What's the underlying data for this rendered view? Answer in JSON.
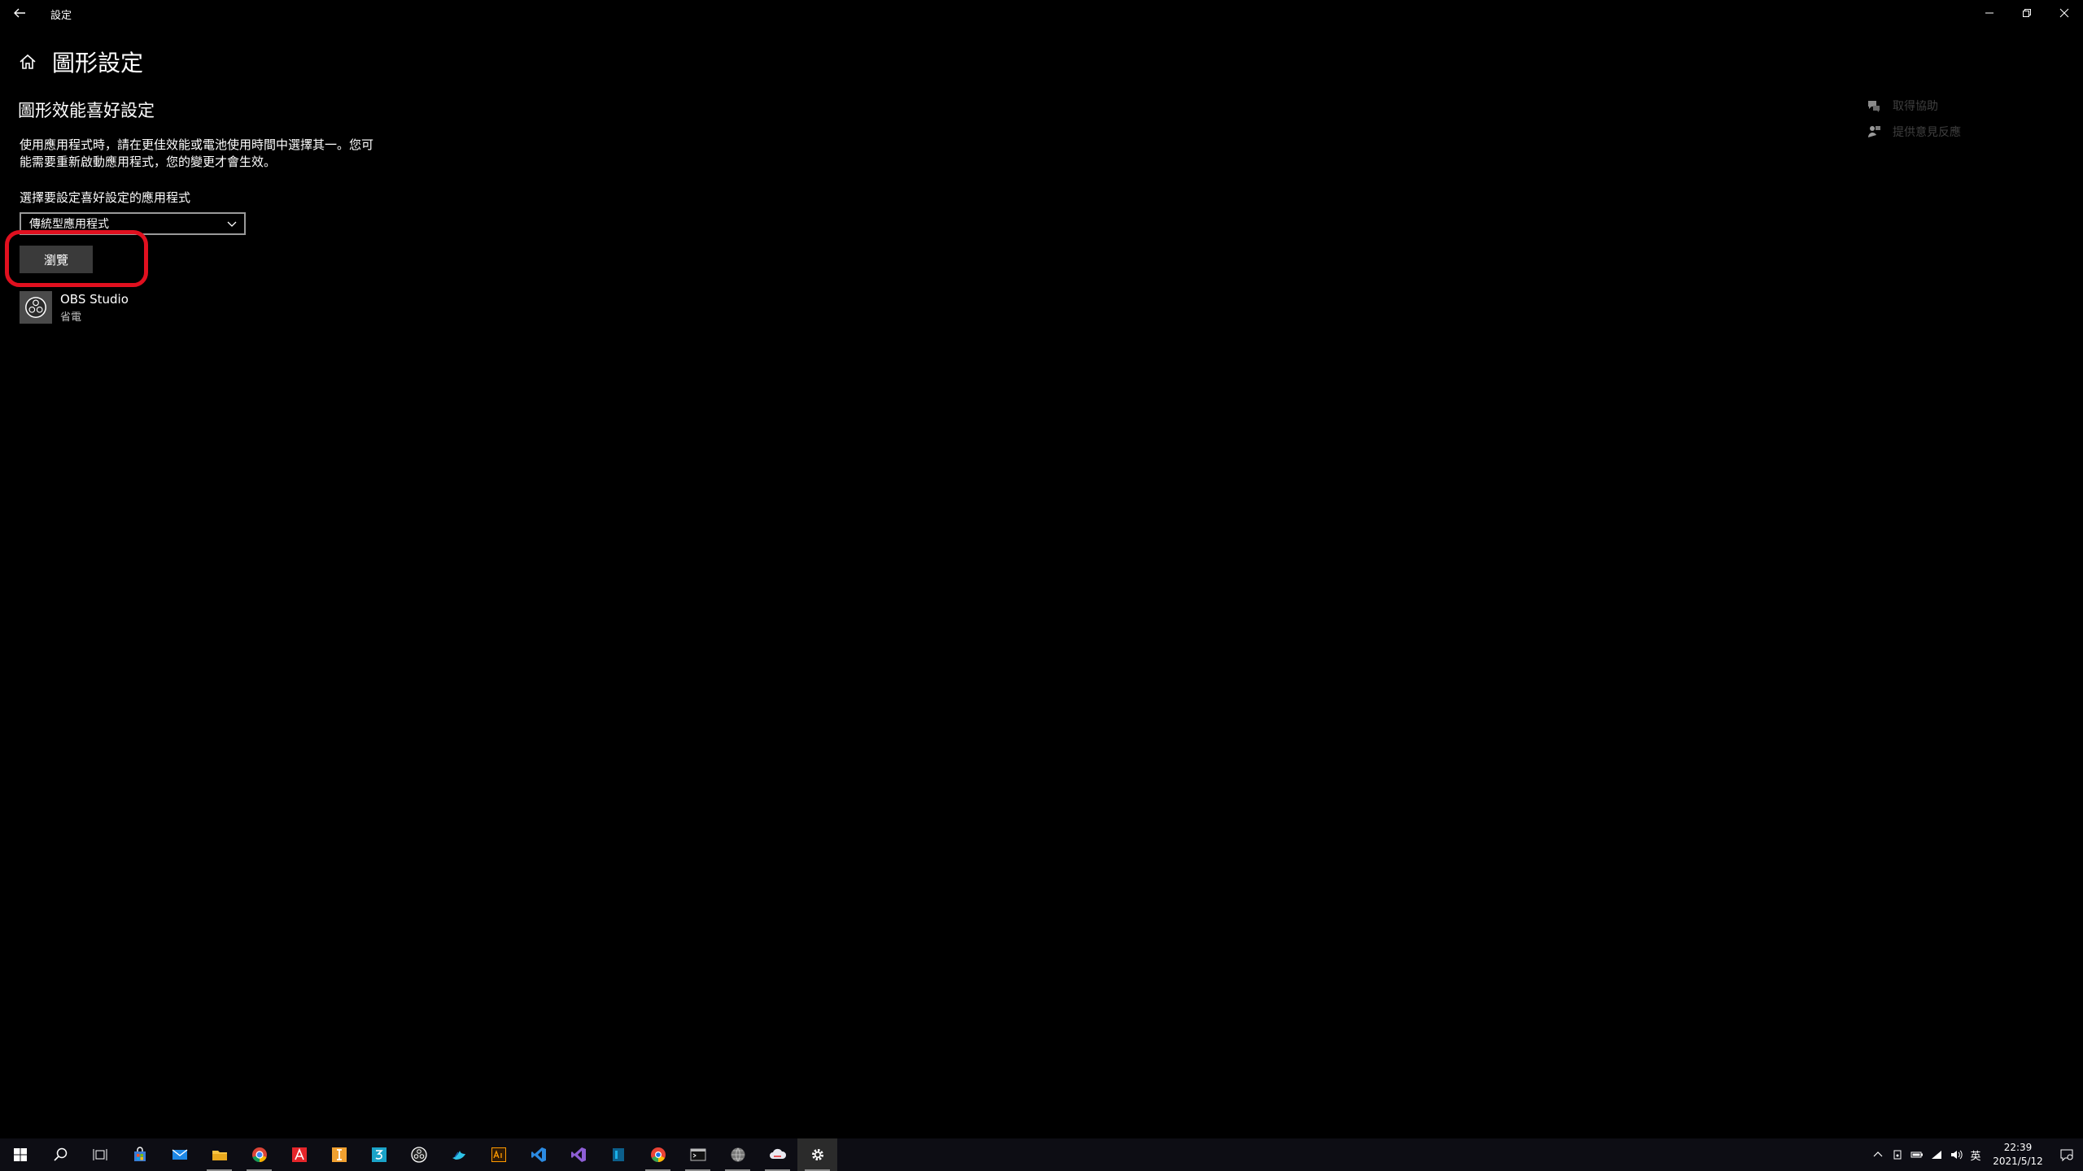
{
  "window": {
    "title": "設定",
    "controls": [
      "minimize-icon",
      "restore-icon",
      "close-icon"
    ]
  },
  "header": {
    "title": "圖形設定"
  },
  "section": {
    "title": "圖形效能喜好設定",
    "description_line1": "使用應用程式時，請在更佳效能或電池使用時間中選擇其一。您可",
    "description_line2": "能需要重新啟動應用程式，您的變更才會生效。",
    "select_label": "選擇要設定喜好設定的應用程式",
    "dropdown_value": "傳統型應用程式",
    "browse_label": "瀏覽",
    "highlight_color": "#e0101f"
  },
  "apps": [
    {
      "name": "OBS Studio",
      "mode": "省電",
      "icon": "obs-icon"
    }
  ],
  "side_links": [
    {
      "label": "取得協助",
      "icon": "help-chat-icon"
    },
    {
      "label": "提供意見反應",
      "icon": "feedback-icon"
    }
  ],
  "taskbar": {
    "items": [
      "windows-start-icon",
      "search-icon",
      "task-view-icon",
      "store-icon",
      "mail-icon",
      "file-explorer-icon",
      "chrome-icon",
      "acrobat-icon",
      "illustrator-i-icon",
      "app-3-icon",
      "obs-icon",
      "app-bird-icon",
      "illustrator-icon",
      "vscode-icon",
      "visual-studio-icon",
      "intellij-icon",
      "browser-icon",
      "terminal-icon",
      "app-globe-icon",
      "app-cloud-icon",
      "settings-icon"
    ],
    "active_item": "settings-icon",
    "tray": {
      "input_method": "英",
      "time": "22:39",
      "date": "2021/5/12"
    }
  }
}
